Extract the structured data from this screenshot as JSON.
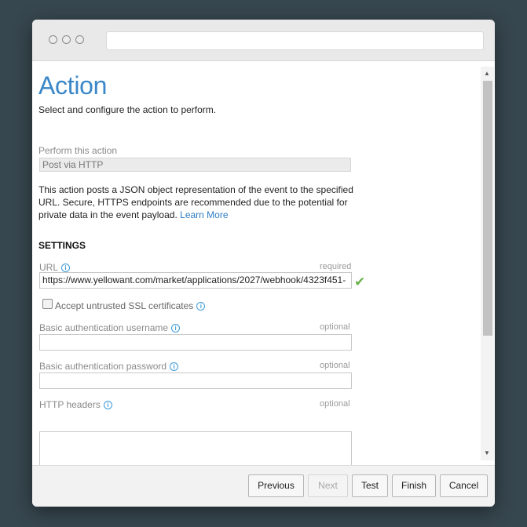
{
  "page": {
    "title": "Action",
    "subtitle": "Select and configure the action to perform."
  },
  "action": {
    "label": "Perform this action",
    "value": "Post via HTTP",
    "description": "This action posts a JSON object representation of the event to the specified URL. Secure, HTTPS endpoints are recommended due to the potential for private data in the event payload.",
    "learn_more": "Learn More"
  },
  "settings": {
    "heading": "SETTINGS",
    "url": {
      "label": "URL",
      "requirement": "required",
      "value": "https://www.yellowant.com/market/applications/2027/webhook/4323f451-"
    },
    "ssl": {
      "label": "Accept untrusted SSL certificates",
      "checked": false
    },
    "username": {
      "label": "Basic authentication username",
      "requirement": "optional",
      "value": ""
    },
    "password": {
      "label": "Basic authentication password",
      "requirement": "optional",
      "value": ""
    },
    "headers": {
      "label": "HTTP headers",
      "requirement": "optional",
      "value": ""
    }
  },
  "footer": {
    "previous": "Previous",
    "next": "Next",
    "test": "Test",
    "finish": "Finish",
    "cancel": "Cancel"
  },
  "colors": {
    "title": "#3b87c8",
    "link": "#2c7cc4",
    "success": "#6ab04c",
    "info": "#3b9ad9",
    "background": "#37474f"
  },
  "icons": {
    "info": "info-icon",
    "valid": "checkmark-icon"
  }
}
